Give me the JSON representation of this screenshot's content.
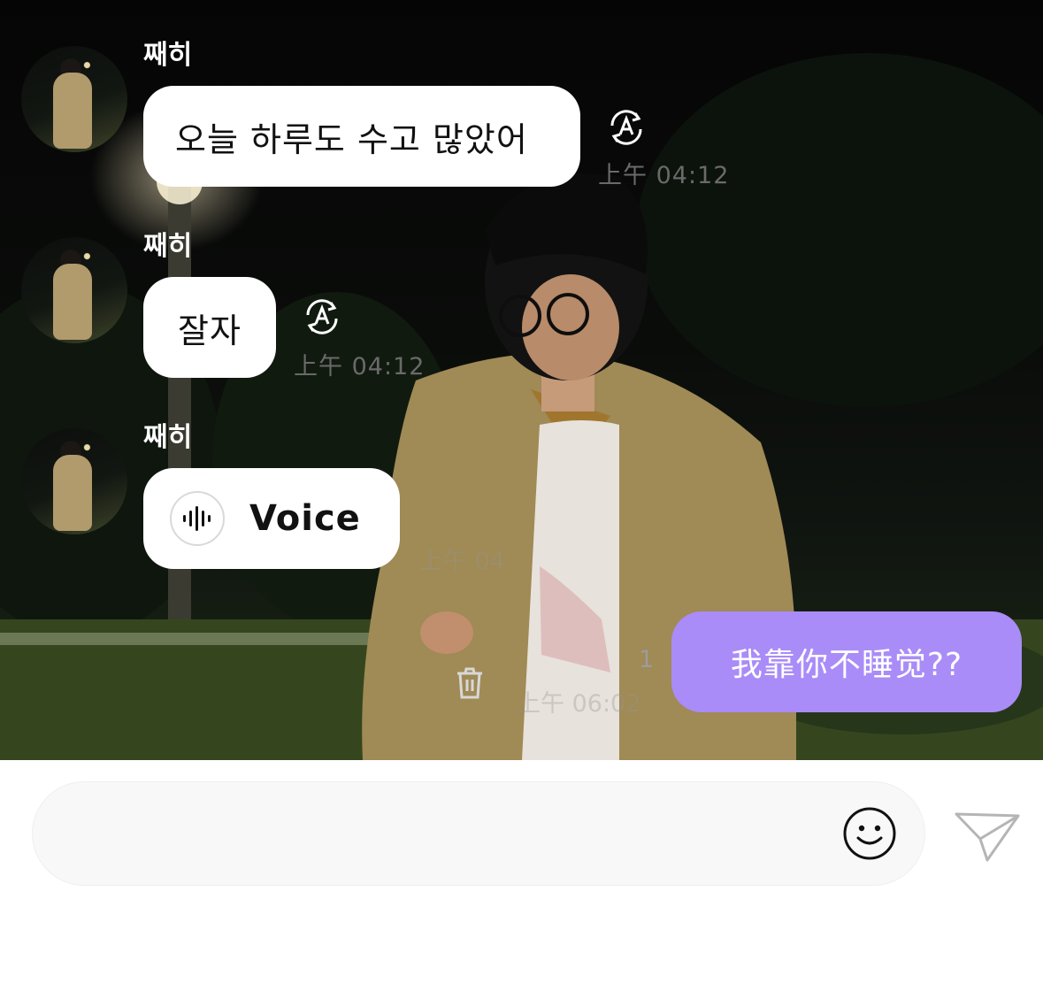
{
  "messages": [
    {
      "sender": "째히",
      "text": "오늘 하루도 수고 많았어",
      "time": "上午 04:12"
    },
    {
      "sender": "째히",
      "text": "잘자",
      "time": "上午 04:12"
    },
    {
      "sender": "째히",
      "type": "voice",
      "text": "Voice"
    }
  ],
  "sent_message": {
    "text": "我靠你不睡觉??",
    "read_count": "1",
    "faded_time": "上午 06:02"
  },
  "faded_behind_voice": "上午 04",
  "composer": {
    "placeholder": ""
  },
  "icons": [
    "avatar",
    "translate-icon",
    "voice-waveform-icon",
    "trash-icon",
    "emoji-icon",
    "send-icon"
  ],
  "colors": {
    "sent_bubble": "#a98cf7",
    "received_bubble": "#ffffff",
    "composer_bg": "#f8f8f8"
  }
}
